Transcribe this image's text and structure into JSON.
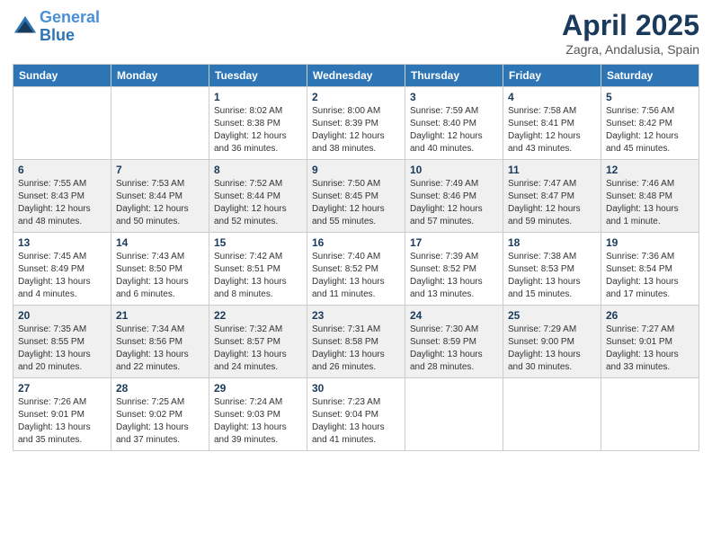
{
  "logo": {
    "line1": "General",
    "line2": "Blue"
  },
  "title": "April 2025",
  "subtitle": "Zagra, Andalusia, Spain",
  "days_of_week": [
    "Sunday",
    "Monday",
    "Tuesday",
    "Wednesday",
    "Thursday",
    "Friday",
    "Saturday"
  ],
  "weeks": [
    [
      {
        "day": "",
        "info": ""
      },
      {
        "day": "",
        "info": ""
      },
      {
        "day": "1",
        "info": "Sunrise: 8:02 AM\nSunset: 8:38 PM\nDaylight: 12 hours\nand 36 minutes."
      },
      {
        "day": "2",
        "info": "Sunrise: 8:00 AM\nSunset: 8:39 PM\nDaylight: 12 hours\nand 38 minutes."
      },
      {
        "day": "3",
        "info": "Sunrise: 7:59 AM\nSunset: 8:40 PM\nDaylight: 12 hours\nand 40 minutes."
      },
      {
        "day": "4",
        "info": "Sunrise: 7:58 AM\nSunset: 8:41 PM\nDaylight: 12 hours\nand 43 minutes."
      },
      {
        "day": "5",
        "info": "Sunrise: 7:56 AM\nSunset: 8:42 PM\nDaylight: 12 hours\nand 45 minutes."
      }
    ],
    [
      {
        "day": "6",
        "info": "Sunrise: 7:55 AM\nSunset: 8:43 PM\nDaylight: 12 hours\nand 48 minutes."
      },
      {
        "day": "7",
        "info": "Sunrise: 7:53 AM\nSunset: 8:44 PM\nDaylight: 12 hours\nand 50 minutes."
      },
      {
        "day": "8",
        "info": "Sunrise: 7:52 AM\nSunset: 8:44 PM\nDaylight: 12 hours\nand 52 minutes."
      },
      {
        "day": "9",
        "info": "Sunrise: 7:50 AM\nSunset: 8:45 PM\nDaylight: 12 hours\nand 55 minutes."
      },
      {
        "day": "10",
        "info": "Sunrise: 7:49 AM\nSunset: 8:46 PM\nDaylight: 12 hours\nand 57 minutes."
      },
      {
        "day": "11",
        "info": "Sunrise: 7:47 AM\nSunset: 8:47 PM\nDaylight: 12 hours\nand 59 minutes."
      },
      {
        "day": "12",
        "info": "Sunrise: 7:46 AM\nSunset: 8:48 PM\nDaylight: 13 hours\nand 1 minute."
      }
    ],
    [
      {
        "day": "13",
        "info": "Sunrise: 7:45 AM\nSunset: 8:49 PM\nDaylight: 13 hours\nand 4 minutes."
      },
      {
        "day": "14",
        "info": "Sunrise: 7:43 AM\nSunset: 8:50 PM\nDaylight: 13 hours\nand 6 minutes."
      },
      {
        "day": "15",
        "info": "Sunrise: 7:42 AM\nSunset: 8:51 PM\nDaylight: 13 hours\nand 8 minutes."
      },
      {
        "day": "16",
        "info": "Sunrise: 7:40 AM\nSunset: 8:52 PM\nDaylight: 13 hours\nand 11 minutes."
      },
      {
        "day": "17",
        "info": "Sunrise: 7:39 AM\nSunset: 8:52 PM\nDaylight: 13 hours\nand 13 minutes."
      },
      {
        "day": "18",
        "info": "Sunrise: 7:38 AM\nSunset: 8:53 PM\nDaylight: 13 hours\nand 15 minutes."
      },
      {
        "day": "19",
        "info": "Sunrise: 7:36 AM\nSunset: 8:54 PM\nDaylight: 13 hours\nand 17 minutes."
      }
    ],
    [
      {
        "day": "20",
        "info": "Sunrise: 7:35 AM\nSunset: 8:55 PM\nDaylight: 13 hours\nand 20 minutes."
      },
      {
        "day": "21",
        "info": "Sunrise: 7:34 AM\nSunset: 8:56 PM\nDaylight: 13 hours\nand 22 minutes."
      },
      {
        "day": "22",
        "info": "Sunrise: 7:32 AM\nSunset: 8:57 PM\nDaylight: 13 hours\nand 24 minutes."
      },
      {
        "day": "23",
        "info": "Sunrise: 7:31 AM\nSunset: 8:58 PM\nDaylight: 13 hours\nand 26 minutes."
      },
      {
        "day": "24",
        "info": "Sunrise: 7:30 AM\nSunset: 8:59 PM\nDaylight: 13 hours\nand 28 minutes."
      },
      {
        "day": "25",
        "info": "Sunrise: 7:29 AM\nSunset: 9:00 PM\nDaylight: 13 hours\nand 30 minutes."
      },
      {
        "day": "26",
        "info": "Sunrise: 7:27 AM\nSunset: 9:01 PM\nDaylight: 13 hours\nand 33 minutes."
      }
    ],
    [
      {
        "day": "27",
        "info": "Sunrise: 7:26 AM\nSunset: 9:01 PM\nDaylight: 13 hours\nand 35 minutes."
      },
      {
        "day": "28",
        "info": "Sunrise: 7:25 AM\nSunset: 9:02 PM\nDaylight: 13 hours\nand 37 minutes."
      },
      {
        "day": "29",
        "info": "Sunrise: 7:24 AM\nSunset: 9:03 PM\nDaylight: 13 hours\nand 39 minutes."
      },
      {
        "day": "30",
        "info": "Sunrise: 7:23 AM\nSunset: 9:04 PM\nDaylight: 13 hours\nand 41 minutes."
      },
      {
        "day": "",
        "info": ""
      },
      {
        "day": "",
        "info": ""
      },
      {
        "day": "",
        "info": ""
      }
    ]
  ]
}
